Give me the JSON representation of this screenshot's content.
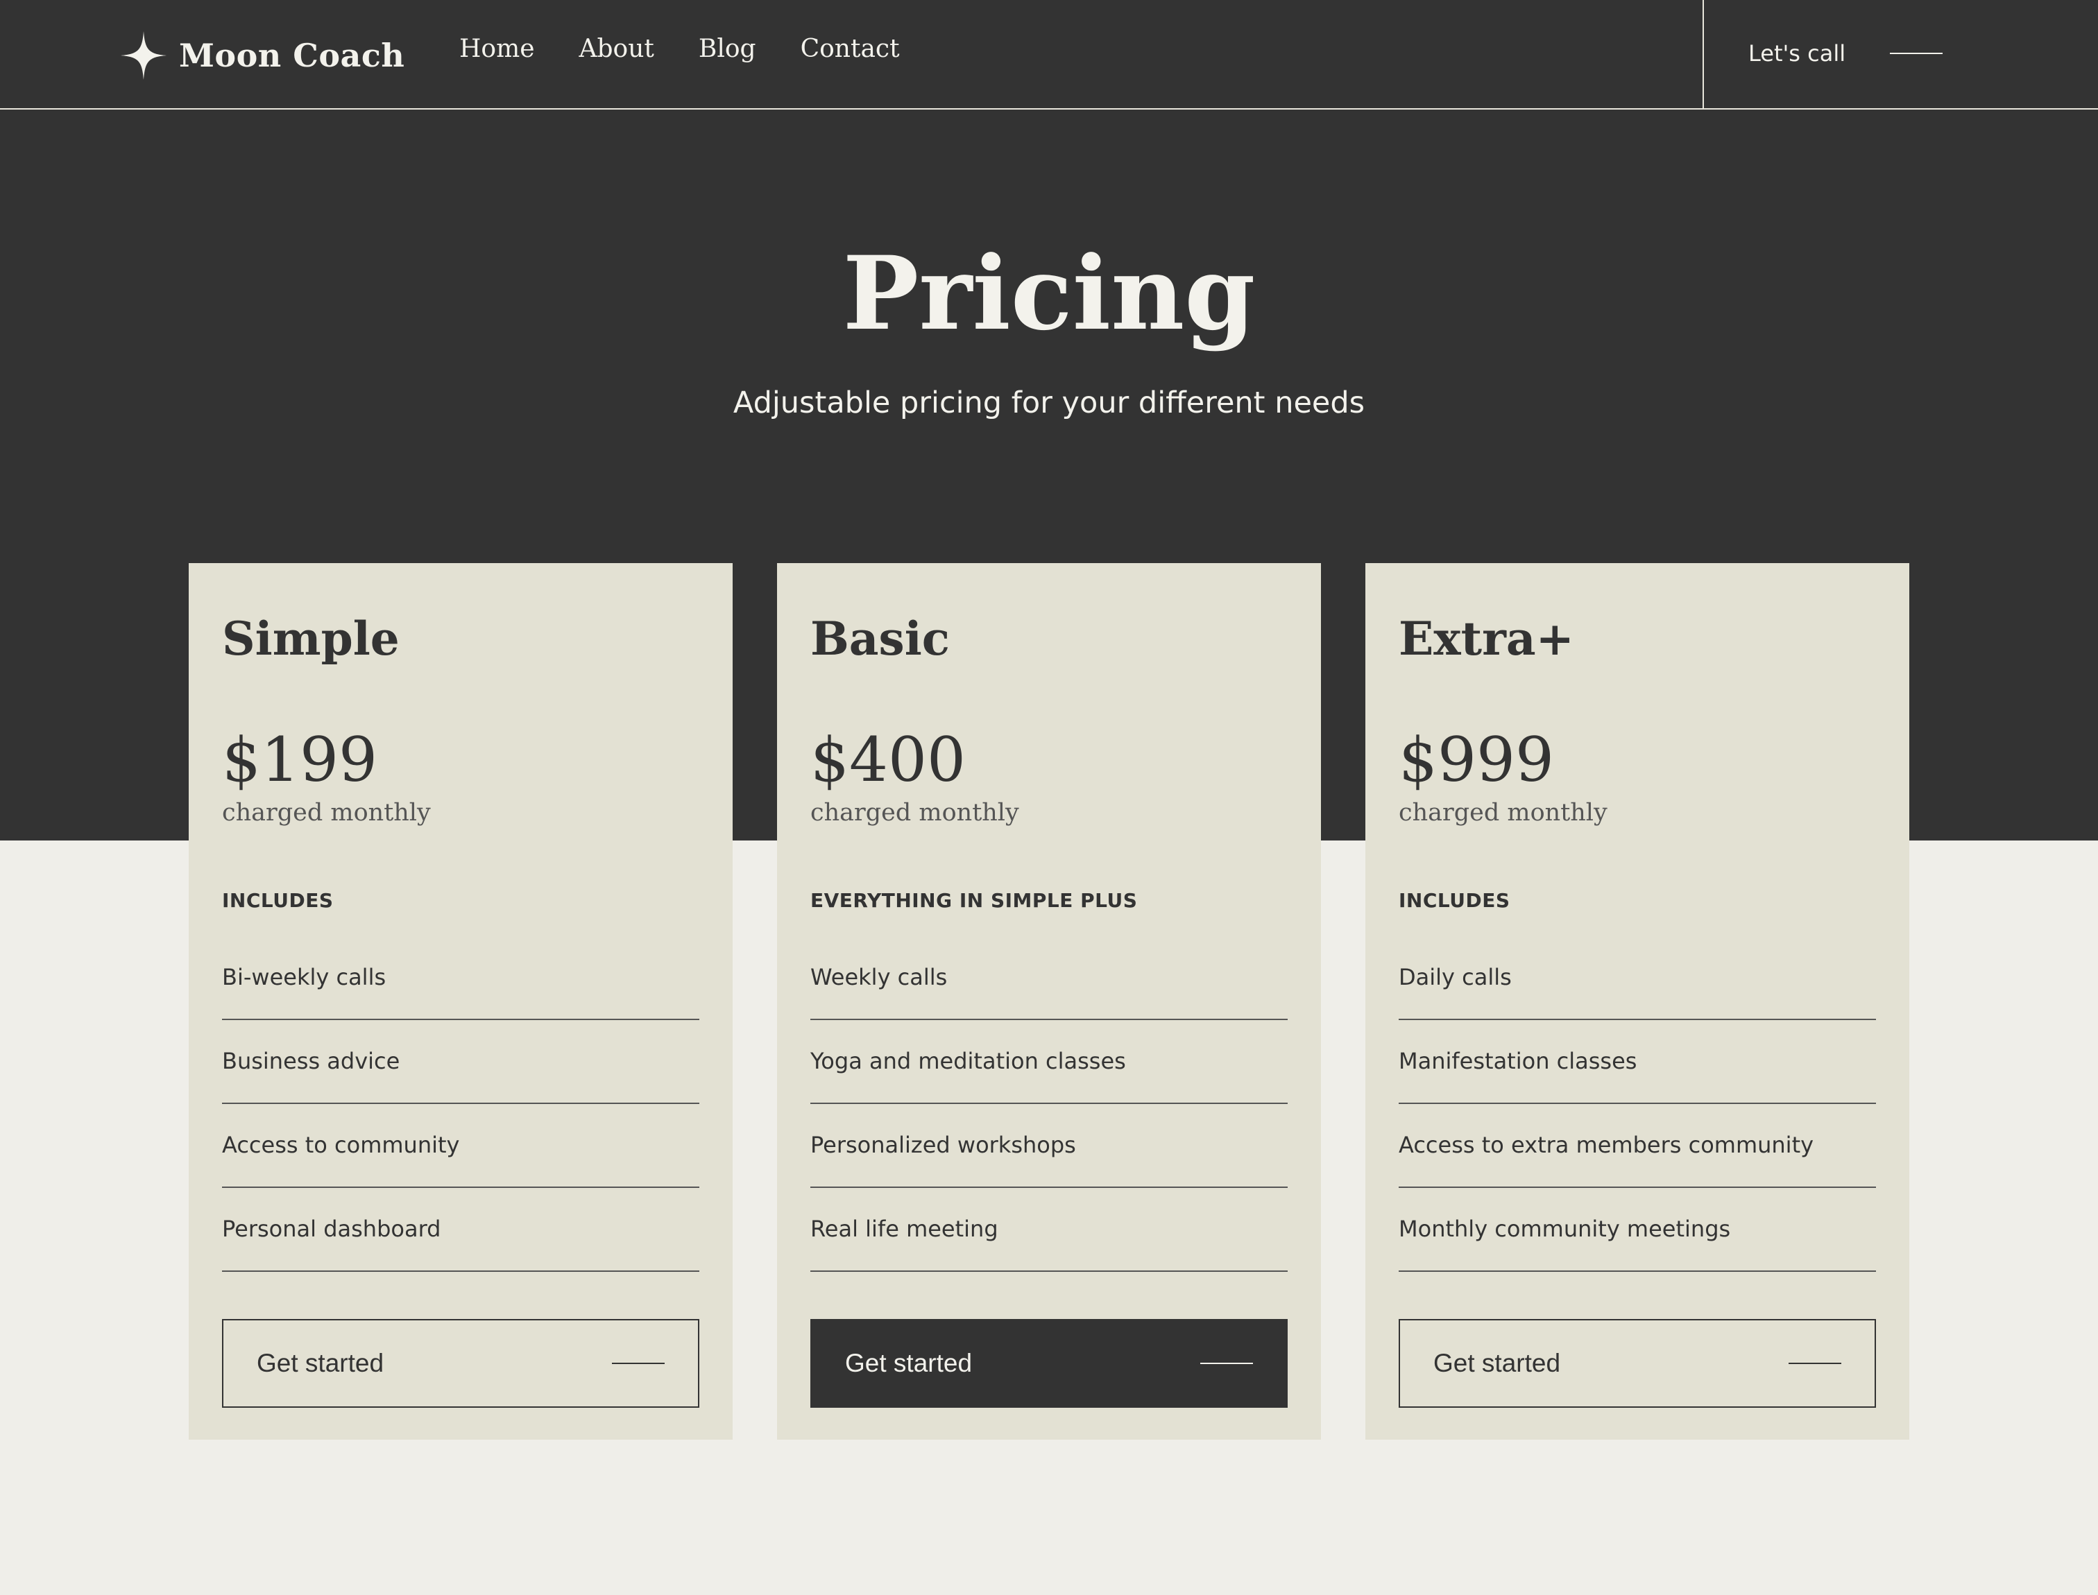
{
  "colors": {
    "dark": "#333333",
    "cream": "#f3f2ec",
    "card_bg": "#e3e1d3",
    "page_bg": "#efeee9"
  },
  "nav": {
    "brand": "Moon Coach",
    "brand_icon": "four-point-star-icon",
    "links": [
      "Home",
      "About",
      "Blog",
      "Contact"
    ],
    "cta_label": "Let's call",
    "cta_icon": "line-arrow-icon"
  },
  "hero": {
    "title": "Pricing",
    "subtitle": "Adjustable pricing for your different needs"
  },
  "plans": [
    {
      "name": "Simple",
      "price": "$199",
      "period": "charged monthly",
      "includes_label": "INCLUDES",
      "features": [
        "Bi-weekly calls",
        "Business advice",
        "Access to community",
        "Personal dashboard"
      ],
      "button_label": "Get started",
      "highlighted": false
    },
    {
      "name": "Basic",
      "price": "$400",
      "period": "charged monthly",
      "includes_label": "EVERYTHING IN SIMPLE PLUS",
      "features": [
        "Weekly calls",
        "Yoga and meditation classes",
        "Personalized workshops",
        "Real life meeting"
      ],
      "button_label": "Get started",
      "highlighted": true
    },
    {
      "name": "Extra+",
      "price": "$999",
      "period": "charged monthly",
      "includes_label": "INCLUDES",
      "features": [
        "Daily calls",
        "Manifestation classes",
        "Access to extra members community",
        "Monthly community meetings"
      ],
      "button_label": "Get started",
      "highlighted": false
    }
  ]
}
